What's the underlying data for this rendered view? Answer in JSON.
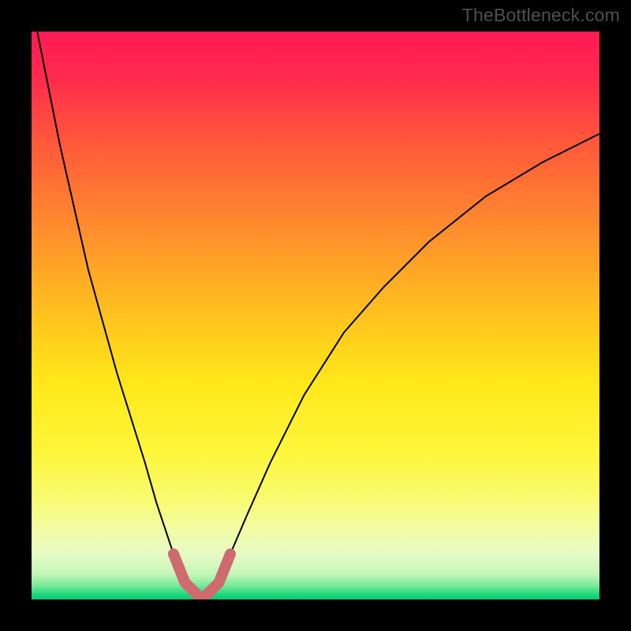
{
  "watermark": "TheBottleneck.com",
  "chart_data": {
    "type": "line",
    "title": "",
    "xlabel": "",
    "ylabel": "",
    "xlim": [
      0,
      100
    ],
    "ylim": [
      0,
      100
    ],
    "grid": false,
    "legend": false,
    "note": "Values are normalized 0–100 in both axes (no numeric axis labels shown). y≈0 is the green band (optimal), y≈100 is at the red top.",
    "series": [
      {
        "name": "bottleneck-curve",
        "color": "#000000",
        "stroke_width": 2,
        "x": [
          1,
          5,
          10,
          15,
          20,
          22,
          25,
          27,
          29,
          30,
          31,
          33,
          35,
          38,
          42,
          48,
          55,
          62,
          70,
          80,
          90,
          100
        ],
        "y": [
          100,
          80,
          58,
          40,
          24,
          17,
          8,
          3,
          1,
          0,
          1,
          3,
          8,
          15,
          24,
          36,
          47,
          55,
          63,
          71,
          77,
          82
        ]
      },
      {
        "name": "optimal-zone-marker",
        "color": "#cf6a6f",
        "stroke_width": 14,
        "x": [
          25,
          27,
          29,
          30,
          31,
          33,
          35
        ],
        "y": [
          8,
          3,
          1,
          0,
          1,
          3,
          8
        ]
      }
    ],
    "background_gradient_stops": [
      {
        "pos": 0.0,
        "color": "#ff1a55"
      },
      {
        "pos": 0.08,
        "color": "#ff2a4d"
      },
      {
        "pos": 0.2,
        "color": "#ff5a3a"
      },
      {
        "pos": 0.35,
        "color": "#ff8e2d"
      },
      {
        "pos": 0.5,
        "color": "#ffc21e"
      },
      {
        "pos": 0.62,
        "color": "#ffe81a"
      },
      {
        "pos": 0.74,
        "color": "#fef63a"
      },
      {
        "pos": 0.82,
        "color": "#f9fb6e"
      },
      {
        "pos": 0.88,
        "color": "#f2fca8"
      },
      {
        "pos": 0.92,
        "color": "#e7fbc6"
      },
      {
        "pos": 0.955,
        "color": "#c4f6b8"
      },
      {
        "pos": 0.975,
        "color": "#7ceb9a"
      },
      {
        "pos": 0.99,
        "color": "#23da7e"
      },
      {
        "pos": 1.0,
        "color": "#07c873"
      }
    ]
  }
}
